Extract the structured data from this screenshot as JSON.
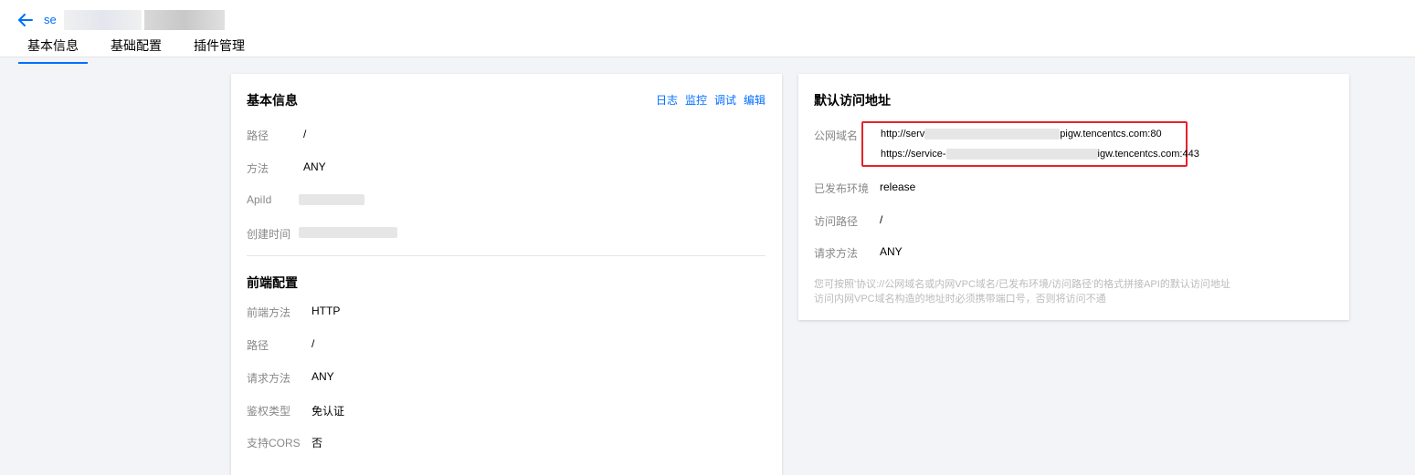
{
  "header": {
    "service_name": "se",
    "tabs": [
      {
        "label": "基本信息",
        "active": true
      },
      {
        "label": "基础配置",
        "active": false
      },
      {
        "label": "插件管理",
        "active": false
      }
    ]
  },
  "basic_info": {
    "title": "基本信息",
    "actions": [
      "日志",
      "监控",
      "调试",
      "编辑"
    ],
    "fields": [
      {
        "label": "路径",
        "value": "/"
      },
      {
        "label": "方法",
        "value": "ANY"
      },
      {
        "label": "ApiId",
        "value": ""
      },
      {
        "label": "创建时间",
        "value": ""
      }
    ]
  },
  "frontend_config": {
    "title": "前端配置",
    "fields": [
      {
        "label": "前端方法",
        "value": "HTTP"
      },
      {
        "label": "路径",
        "value": "/"
      },
      {
        "label": "请求方法",
        "value": "ANY"
      },
      {
        "label": "鉴权类型",
        "value": "免认证"
      },
      {
        "label": "支持CORS",
        "value": "否"
      }
    ]
  },
  "default_access": {
    "title": "默认访问地址",
    "public_domain_label": "公网域名",
    "url_http_prefix": "http://serv",
    "url_http_suffix": "pigw.tencentcs.com:80",
    "url_https_prefix": "https://service-",
    "url_https_suffix": "igw.tencentcs.com:443",
    "fields": [
      {
        "label": "已发布环境",
        "value": "release"
      },
      {
        "label": "访问路径",
        "value": "/"
      },
      {
        "label": "请求方法",
        "value": "ANY"
      }
    ],
    "note_line1": "您可按照'协议://公网域名或内网VPC域名/已发布环境/访问路径'的格式拼接API的默认访问地址",
    "note_line2": "访问内网VPC域名构造的地址时必须携带端口号，否则将访问不通"
  },
  "colors": {
    "accent": "#006eff",
    "highlight": "#e5232b"
  }
}
